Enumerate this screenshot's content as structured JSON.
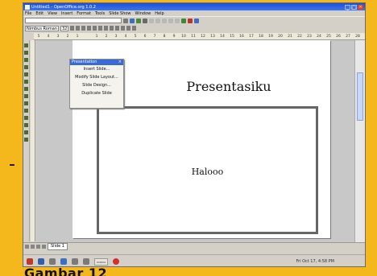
{
  "window": {
    "title": "Untitled1 - OpenOffice.org 1.0.2"
  },
  "menubar": [
    "File",
    "Edit",
    "View",
    "Insert",
    "Format",
    "Tools",
    "Slide Show",
    "Window",
    "Help"
  ],
  "format_bar": {
    "font_name": "Nimbus Roman",
    "font_size": "32"
  },
  "ruler_numbers": [
    "5",
    "4",
    "3",
    "2",
    "1",
    "",
    "1",
    "2",
    "3",
    "4",
    "5",
    "6",
    "7",
    "8",
    "9",
    "10",
    "11",
    "12",
    "13",
    "14",
    "15",
    "16",
    "17",
    "18",
    "19",
    "20",
    "21",
    "22",
    "23",
    "24",
    "25",
    "26",
    "27",
    "28",
    "29",
    "30"
  ],
  "context_menu": {
    "header": "Presentation",
    "items": [
      "Insert Slide...",
      "Modify Slide Layout...",
      "Slide Design...",
      "Duplicate Slide"
    ]
  },
  "slide": {
    "title": "Presentasiku",
    "content": "Halooo"
  },
  "bottom_tabs": {
    "slide_tab": "Slide 1"
  },
  "taskbar": {
    "clock": "Fri Oct 17, 4:58 PM"
  },
  "caption": "Gambar 12"
}
